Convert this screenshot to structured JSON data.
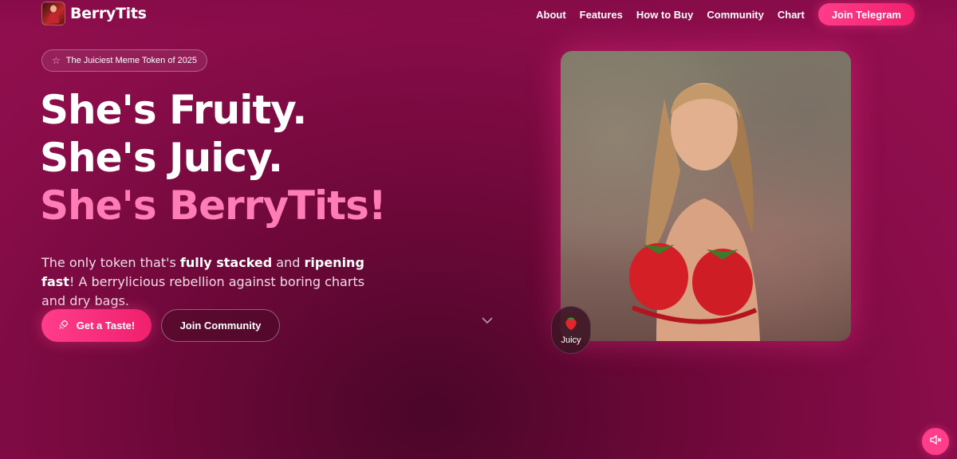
{
  "brand": {
    "name": "BerryTits",
    "logo_icon": "brand-logo-image"
  },
  "nav": {
    "links": [
      "About",
      "Features",
      "How to Buy",
      "Community",
      "Chart"
    ],
    "cta": "Join Telegram"
  },
  "hero": {
    "badge": "The Juiciest Meme Token of 2025",
    "badge_icon": "star-icon",
    "headline_1": "She's Fruity.",
    "headline_2": "She's Juicy.",
    "headline_3": "She's BerryTits!",
    "lede_1": "The only token that's ",
    "lede_bold_1": "fully stacked",
    "lede_2": " and ",
    "lede_bold_2": "ripening fast",
    "lede_3": "! A berrylicious rebellion against boring charts and dry bags.",
    "primary_button": "Get a Taste!",
    "primary_icon": "rocket-icon",
    "secondary_button": "Join Community",
    "scroll_icon": "chevron-down-icon",
    "image_icon": "hero-image",
    "chip_label": "Juicy",
    "chip_icon": "strawberry-icon"
  },
  "audio": {
    "icon": "speaker-mute-icon"
  },
  "colors": {
    "accent": "#ff3d8a",
    "headline_pink": "#ff7db7",
    "background": "#7a0a40"
  }
}
